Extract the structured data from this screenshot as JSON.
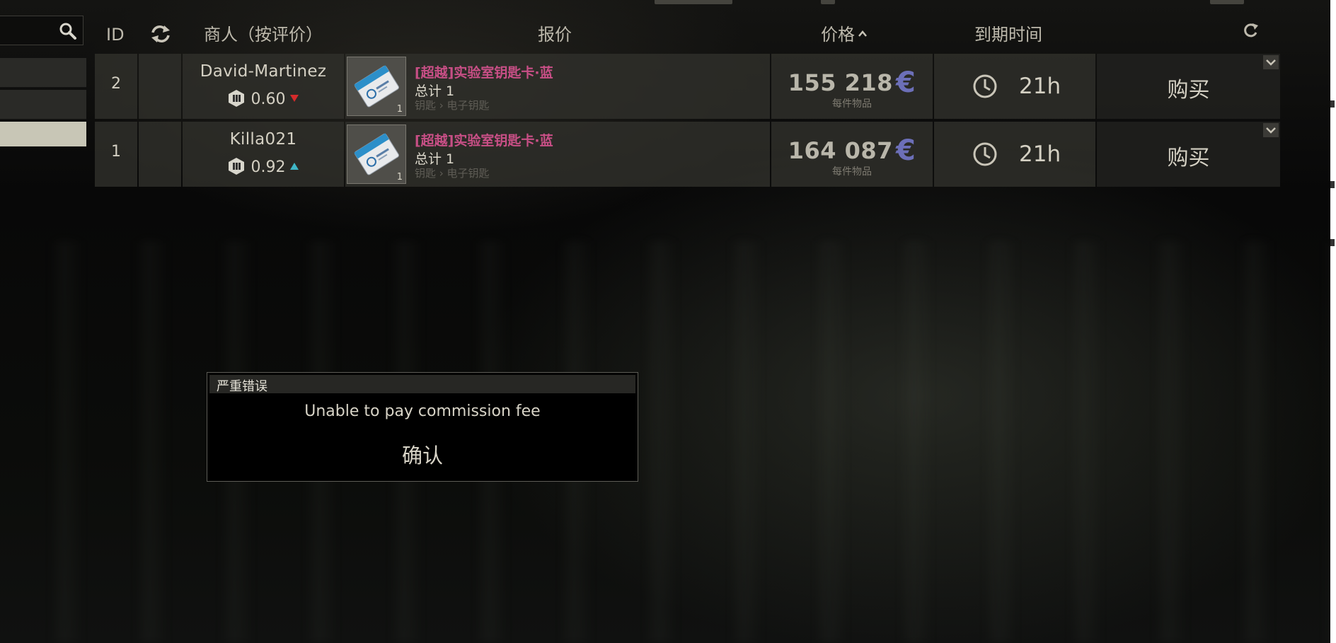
{
  "header": {
    "id": "ID",
    "merchant": "商人（按评价）",
    "offer": "报价",
    "price": "价格",
    "expiry": "到期时间"
  },
  "rows": [
    {
      "id": "2",
      "merchant": "David-Martinez",
      "rating": "0.60",
      "rating_trend": "down",
      "item_name": "[超越]实验室钥匙卡·蓝",
      "item_total": "总计 1",
      "item_category": "钥匙 › 电子钥匙",
      "item_qty": "1",
      "price": "155 218",
      "currency_symbol": "€",
      "price_sub": "每件物品",
      "expires": "21h",
      "buy_label": "购买"
    },
    {
      "id": "1",
      "merchant": "Killa021",
      "rating": "0.92",
      "rating_trend": "up",
      "item_name": "[超越]实验室钥匙卡·蓝",
      "item_total": "总计 1",
      "item_category": "钥匙 › 电子钥匙",
      "item_qty": "1",
      "price": "164 087",
      "currency_symbol": "€",
      "price_sub": "每件物品",
      "expires": "21h",
      "buy_label": "购买"
    }
  ],
  "dialog": {
    "title": "严重错误",
    "message": "Unable to pay commission fee",
    "confirm_label": "确认"
  },
  "colors": {
    "item_name": "#c84f86",
    "currency": "#6c6fb8",
    "trend_down": "#d42b2b",
    "trend_up": "#3fb6c6"
  },
  "icons": {
    "search": "search-icon",
    "swap": "swap-icon",
    "sort": "chevron-up-icon",
    "refresh": "refresh-icon",
    "clock": "clock-icon",
    "rating": "rating-badge-icon",
    "expand": "chevron-down-icon"
  }
}
